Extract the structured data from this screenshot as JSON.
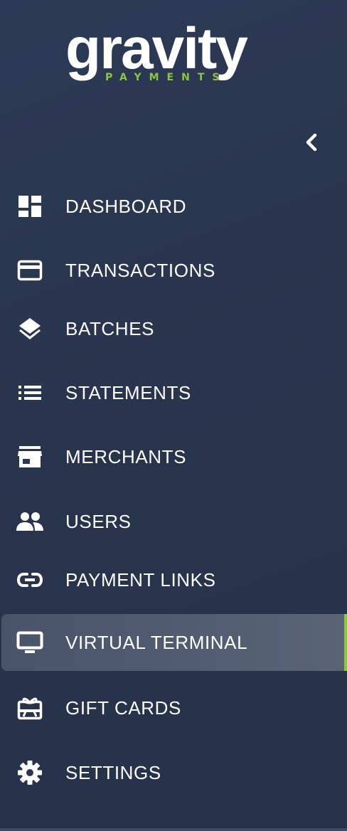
{
  "brand": {
    "name": "gravity",
    "tagline": "PAYMENTS",
    "accent_color": "#8cc63f",
    "background_color": "#2a3750"
  },
  "collapse_button": {
    "icon": "chevron-left-icon"
  },
  "nav": {
    "items": [
      {
        "label": "DASHBOARD",
        "icon": "dashboard-icon",
        "active": false
      },
      {
        "label": "TRANSACTIONS",
        "icon": "credit-card-icon",
        "active": false
      },
      {
        "label": "BATCHES",
        "icon": "layers-icon",
        "active": false
      },
      {
        "label": "STATEMENTS",
        "icon": "list-icon",
        "active": false
      },
      {
        "label": "MERCHANTS",
        "icon": "storefront-icon",
        "active": false
      },
      {
        "label": "USERS",
        "icon": "people-icon",
        "active": false
      },
      {
        "label": "PAYMENT LINKS",
        "icon": "link-icon",
        "active": false
      },
      {
        "label": "VIRTUAL TERMINAL",
        "icon": "monitor-icon",
        "active": true
      },
      {
        "label": "GIFT CARDS",
        "icon": "gift-card-icon",
        "active": false
      },
      {
        "label": "SETTINGS",
        "icon": "gear-icon",
        "active": false
      }
    ]
  }
}
